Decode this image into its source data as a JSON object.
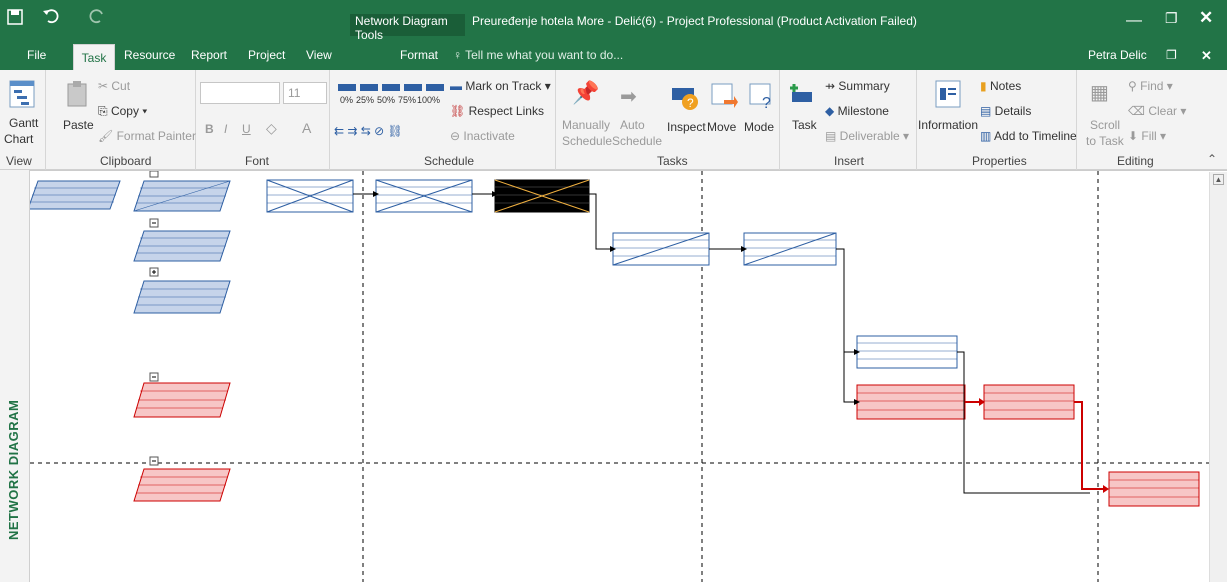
{
  "titlebar": {
    "tool_context": "Network Diagram Tools",
    "title": "Preuređenje hotela More - Delić(6) - Project Professional (Product Activation Failed)",
    "user": "Petra Delic"
  },
  "tabs": {
    "file": "File",
    "task": "Task",
    "resource": "Resource",
    "report": "Report",
    "project": "Project",
    "view": "View",
    "format": "Format",
    "tell_me": "Tell me what you want to do..."
  },
  "ribbon": {
    "view": {
      "gantt_line1": "Gantt",
      "gantt_line2": "Chart",
      "label": "View"
    },
    "clipboard": {
      "paste": "Paste",
      "cut": "Cut",
      "copy": "Copy",
      "format_painter": "Format Painter",
      "label": "Clipboard"
    },
    "font": {
      "size": "11",
      "bold": "B",
      "italic": "I",
      "underline": "U",
      "label": "Font"
    },
    "schedule": {
      "p0": "0%",
      "p25": "25%",
      "p50": "50%",
      "p75": "75%",
      "p100": "100%",
      "mark_on_track": "Mark on Track",
      "respect_links": "Respect Links",
      "inactivate": "Inactivate",
      "label": "Schedule"
    },
    "tasks": {
      "manually": "Manually",
      "manually2": "Schedule",
      "auto": "Auto",
      "auto2": "Schedule",
      "inspect": "Inspect",
      "move": "Move",
      "mode": "Mode",
      "label": "Tasks"
    },
    "insert": {
      "task": "Task",
      "summary": "Summary",
      "milestone": "Milestone",
      "deliverable": "Deliverable",
      "label": "Insert"
    },
    "properties": {
      "information": "Information",
      "notes": "Notes",
      "details": "Details",
      "add_to_timeline": "Add to Timeline",
      "label": "Properties"
    },
    "editing": {
      "scroll": "Scroll",
      "scroll2": "to Task",
      "find": "Find",
      "clear": "Clear",
      "fill": "Fill",
      "label": "Editing"
    }
  },
  "view_name": "NETWORK DIAGRAM",
  "colors": {
    "brand": "#217346",
    "critical": "#cc0000",
    "noncritical": "#2e5fa3"
  }
}
